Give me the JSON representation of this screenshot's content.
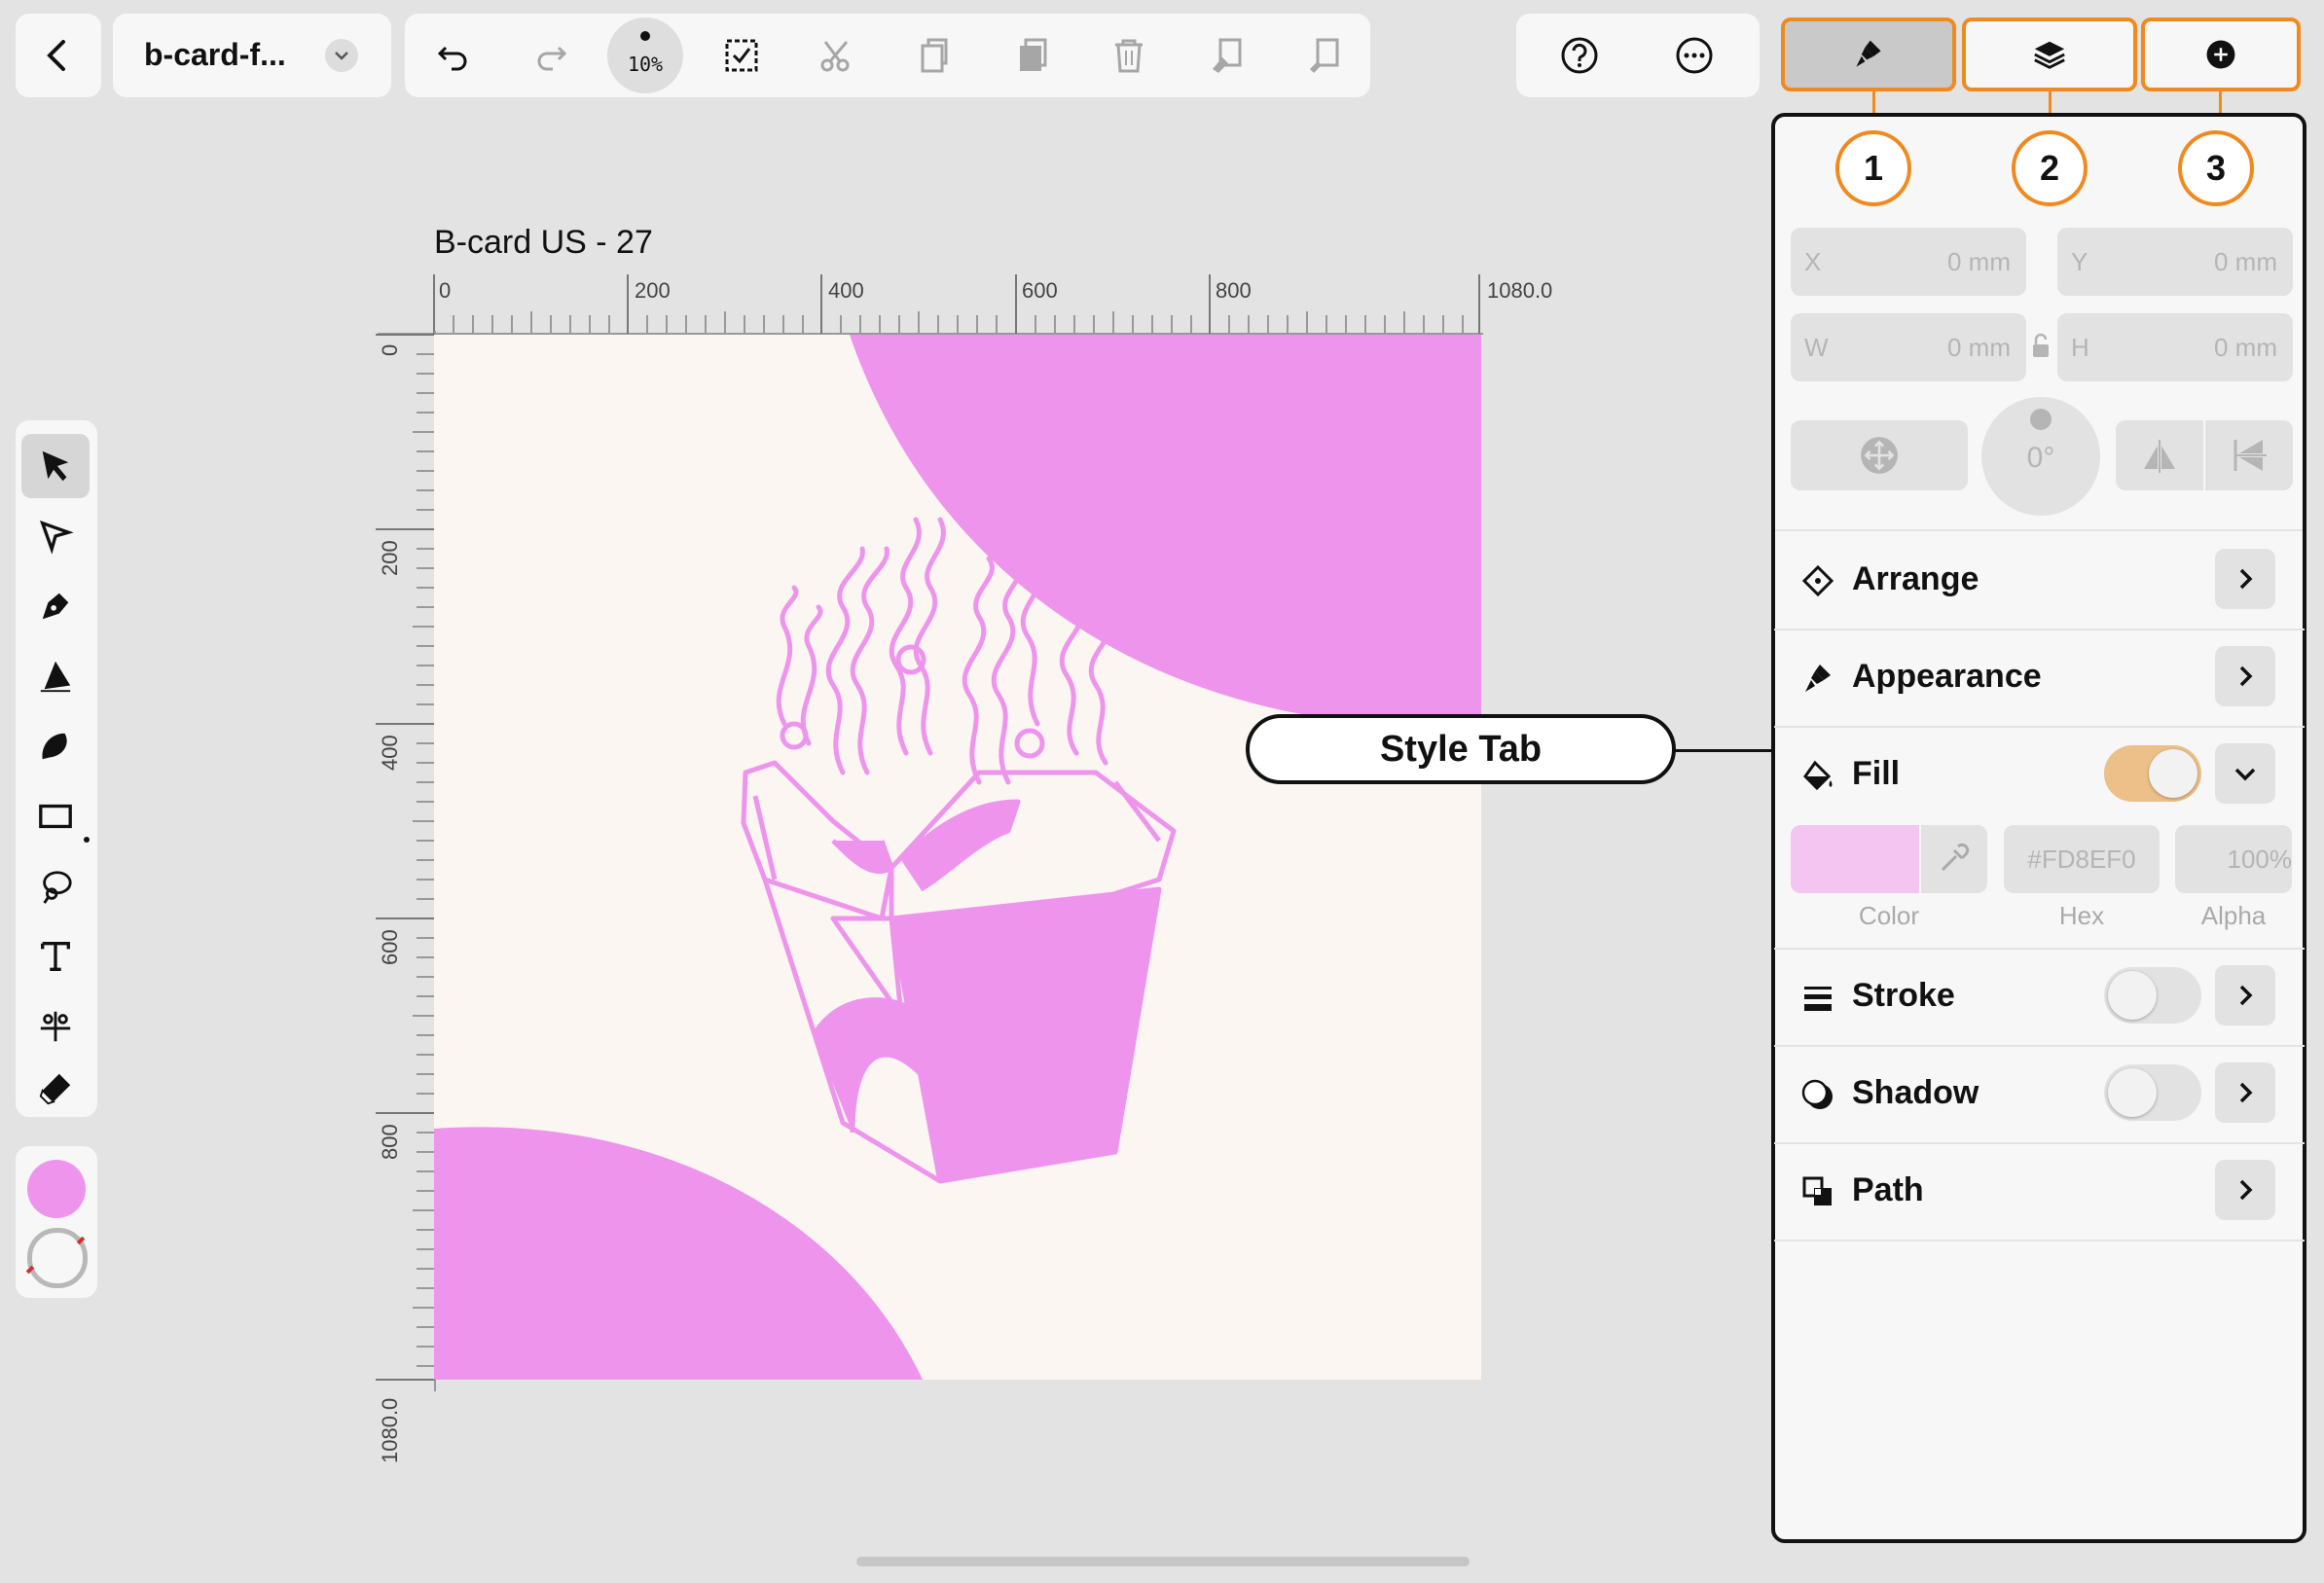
{
  "toolbar": {
    "doc_name": "b-card-f...",
    "zoom": "10%"
  },
  "artboard": {
    "title": "B-card US - 27",
    "h_ticks": [
      "0",
      "200",
      "400",
      "600",
      "800",
      "1080.0"
    ],
    "v_ticks": [
      "0",
      "200",
      "400",
      "600",
      "800",
      "1080.0"
    ],
    "colors": {
      "background": "#FBF6F2",
      "accent": "#EE94EC"
    }
  },
  "left_tools": {
    "tools": [
      "select-tool",
      "node-tool",
      "pen-tool",
      "pencil-tool",
      "brush-tool",
      "rectangle-tool",
      "fill-tool",
      "text-tool",
      "scissors-tool",
      "eraser-tool"
    ],
    "fill_color": "#EE94EC"
  },
  "inspector": {
    "tabs": [
      "style-tab",
      "layers-tab",
      "add-tab"
    ],
    "callouts": [
      "1",
      "2",
      "3"
    ],
    "x": {
      "label": "X",
      "value": "0 mm"
    },
    "y": {
      "label": "Y",
      "value": "0 mm"
    },
    "w": {
      "label": "W",
      "value": "0 mm"
    },
    "h": {
      "label": "H",
      "value": "0 mm"
    },
    "rotation": "0°",
    "arrange": "Arrange",
    "appearance": "Appearance",
    "fill": {
      "label": "Fill",
      "enabled": true,
      "color": "#FD8EF0",
      "hex": "#FD8EF0",
      "alpha": "100%",
      "color_label": "Color",
      "hex_label": "Hex",
      "alpha_label": "Alpha"
    },
    "stroke": {
      "label": "Stroke",
      "enabled": false
    },
    "shadow": {
      "label": "Shadow",
      "enabled": false
    },
    "path": "Path"
  },
  "annotation": {
    "style_tab": "Style Tab"
  }
}
